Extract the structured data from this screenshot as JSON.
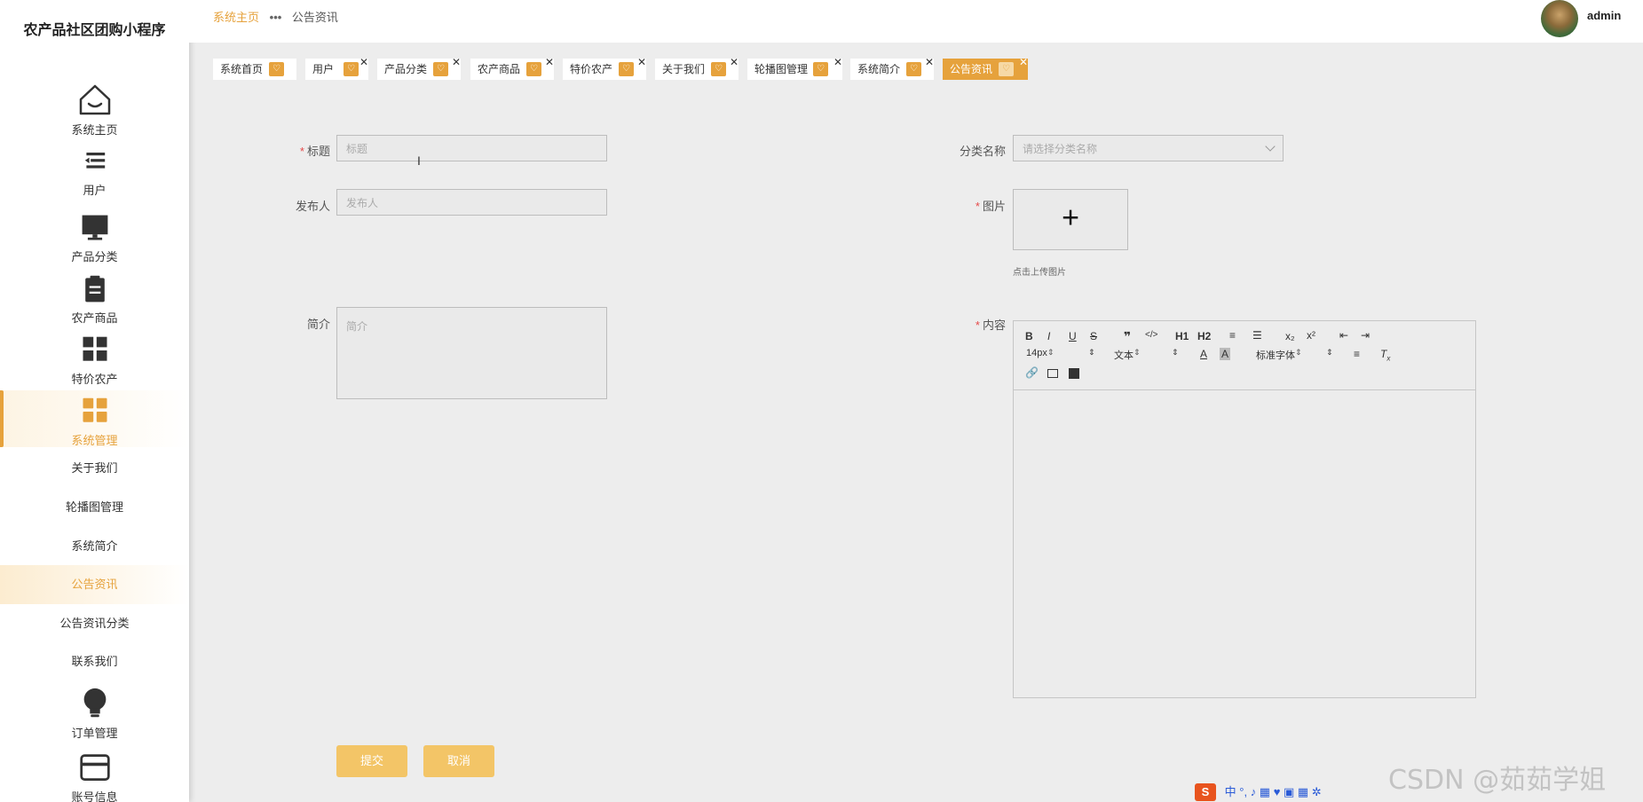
{
  "app": {
    "title": "农产品社区团购小程序"
  },
  "sidebar": {
    "items": [
      {
        "label": "系统主页",
        "icon": "home-icon"
      },
      {
        "label": "用户",
        "icon": "list-icon"
      },
      {
        "label": "产品分类",
        "icon": "monitor-icon"
      },
      {
        "label": "农产商品",
        "icon": "clipboard-icon"
      },
      {
        "label": "特价农产",
        "icon": "grid-icon"
      },
      {
        "label": "系统管理",
        "icon": "grid-icon"
      },
      {
        "label": "订单管理",
        "icon": "bulb-icon"
      },
      {
        "label": "账号信息",
        "icon": "card-icon"
      }
    ],
    "sub_items": [
      "关于我们",
      "轮播图管理",
      "系统简介",
      "公告资讯",
      "公告资讯分类",
      "联系我们"
    ]
  },
  "header": {
    "breadcrumb_home": "系统主页",
    "breadcrumb_sep": "•••",
    "breadcrumb_current": "公告资讯",
    "user": "admin"
  },
  "tabs": [
    "系统首页",
    "用户",
    "产品分类",
    "农产商品",
    "特价农产",
    "关于我们",
    "轮播图管理",
    "系统简介",
    "公告资讯"
  ],
  "form": {
    "title_label": "标题",
    "title_placeholder": "标题",
    "publisher_label": "发布人",
    "publisher_placeholder": "发布人",
    "summary_label": "简介",
    "summary_placeholder": "简介",
    "category_label": "分类名称",
    "category_placeholder": "请选择分类名称",
    "image_label": "图片",
    "upload_hint": "点击上传图片",
    "content_label": "内容",
    "required_mark": "*"
  },
  "editor": {
    "buttons": [
      "B",
      "I",
      "U",
      "S",
      "❞",
      "</>",
      "H1",
      "H2",
      "≡",
      "☰",
      "x₂",
      "x²",
      "⇤",
      "⇥"
    ],
    "font_size": "14px",
    "paragraph": "文本",
    "font_family": "标准字体"
  },
  "actions": {
    "submit": "提交",
    "cancel": "取消"
  },
  "watermark": "CSDN @茹茹学姐",
  "ime": {
    "logo": "S",
    "lang": "中"
  },
  "colors": {
    "accent": "#e6a23c",
    "button": "#f3c567",
    "required": "#e64a4a"
  }
}
